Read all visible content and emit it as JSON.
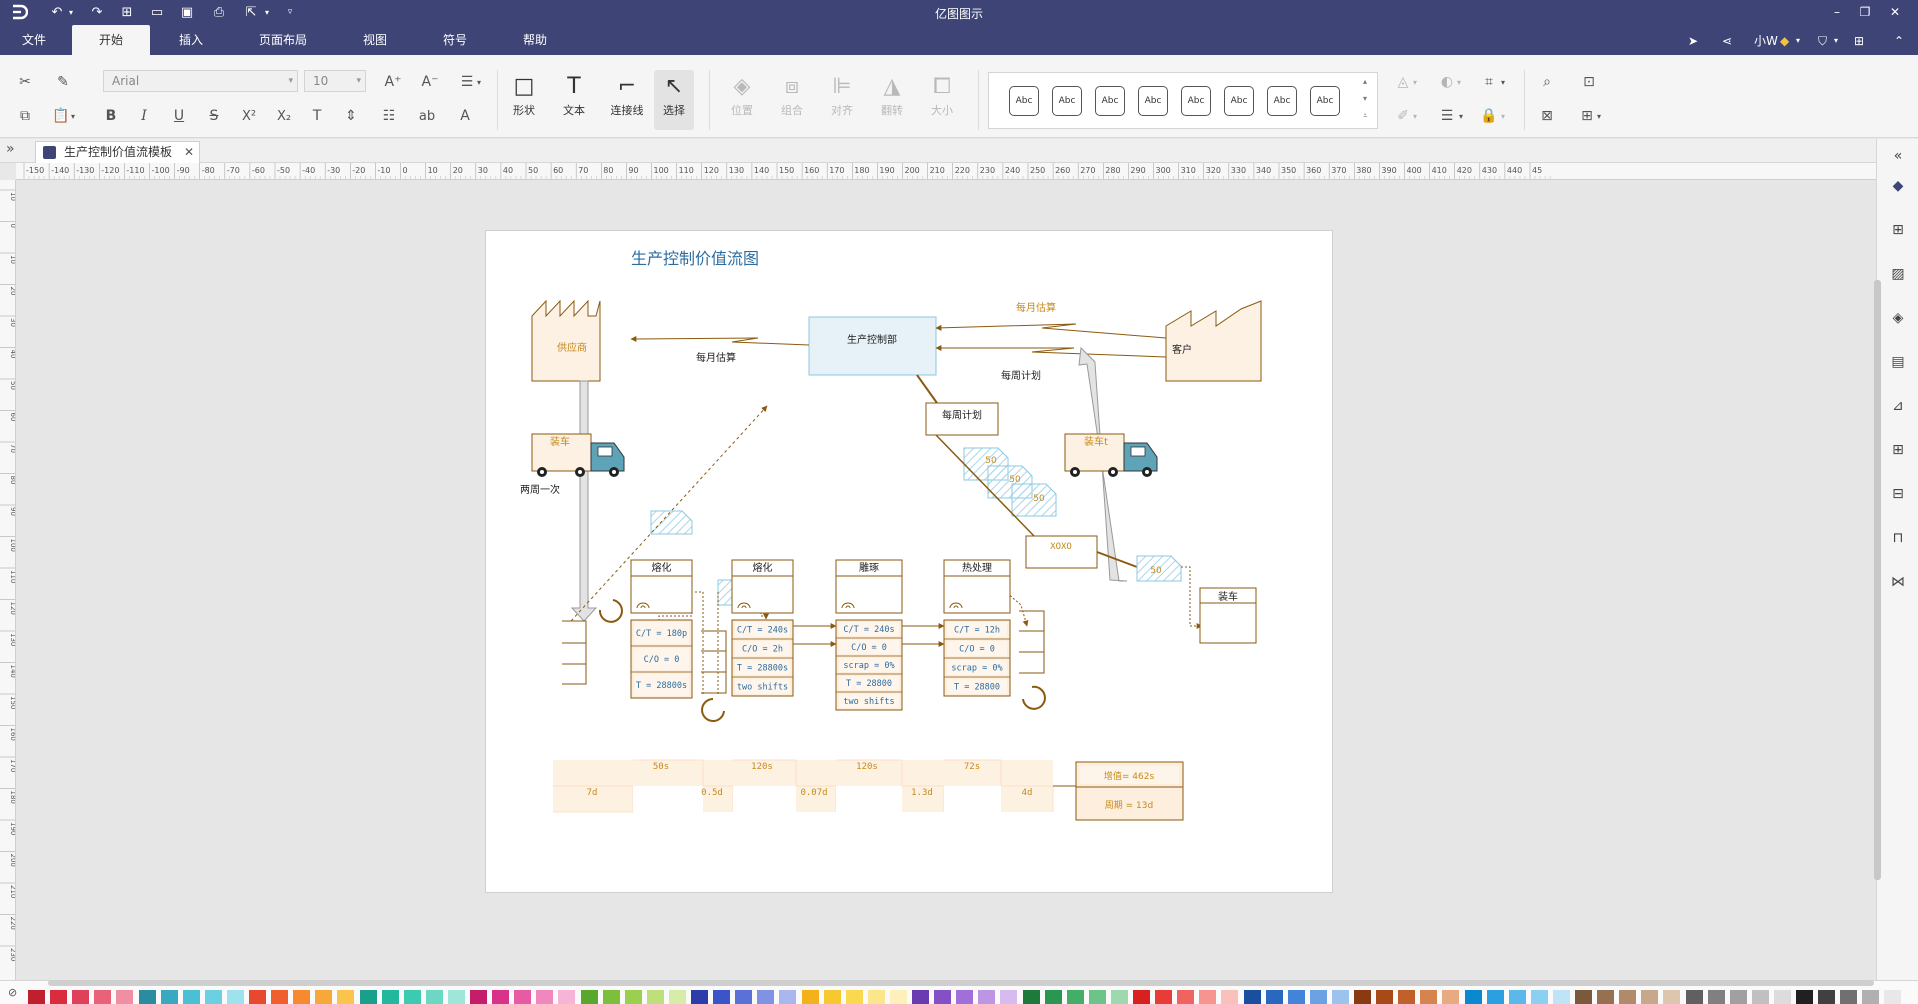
{
  "app": {
    "title": "亿图图示",
    "user": "小W"
  },
  "menu": {
    "items": [
      {
        "label": "文件"
      },
      {
        "label": "开始"
      },
      {
        "label": "插入"
      },
      {
        "label": "页面布局"
      },
      {
        "label": "视图"
      },
      {
        "label": "符号"
      },
      {
        "label": "帮助"
      }
    ]
  },
  "ribbon": {
    "font_family": "Arial",
    "font_size": "10",
    "shape_label": "形状",
    "text_label": "文本",
    "connector_label": "连接线",
    "select_label": "选择",
    "position_label": "位置",
    "group_label": "组合",
    "align_label": "对齐",
    "flip_label": "翻转",
    "size_label": "大小",
    "style_sample": "Abc",
    "superscript": "X²",
    "subscript": "X₂",
    "abbr": "ab"
  },
  "tabs": [
    {
      "label": "生产控制价值流模板"
    }
  ],
  "ruler": {
    "h_ticks": [
      "-150",
      "-140",
      "-130",
      "-120",
      "-110",
      "-100",
      "-90",
      "-80",
      "-70",
      "-60",
      "-50",
      "-40",
      "-30",
      "-20",
      "-10",
      "0",
      "10",
      "20",
      "30",
      "40",
      "50",
      "60",
      "70",
      "80",
      "90",
      "100",
      "110",
      "120",
      "130",
      "140",
      "150",
      "160",
      "170",
      "180",
      "190",
      "200",
      "210",
      "220",
      "230",
      "240",
      "250",
      "260",
      "270",
      "280",
      "290",
      "300",
      "310",
      "320",
      "330",
      "340",
      "350",
      "360",
      "370",
      "380",
      "390",
      "400",
      "410",
      "420",
      "430",
      "440",
      "45"
    ],
    "v_ticks": [
      "10",
      "0",
      "10",
      "20",
      "30",
      "40",
      "50",
      "60",
      "70",
      "80",
      "90",
      "100",
      "110",
      "120",
      "130",
      "140",
      "150",
      "160",
      "170",
      "180",
      "190",
      "200",
      "210",
      "220",
      "230"
    ]
  },
  "diagram": {
    "title": "生产控制价值流图",
    "supplier": "供应商",
    "customer": "客户",
    "control": "生产控制部",
    "monthly_forecast_left": "每月估算",
    "monthly_forecast_right": "每月估算",
    "weekly_plan_right": "每周计划",
    "weekly_plan_box": "每周计划",
    "truck_left": "装车",
    "truck_right": "装车t",
    "biweekly": "两周一次",
    "kanban": [
      "50",
      "50",
      "50"
    ],
    "xoxo": "XOXO",
    "kanban_right": "50",
    "shipping": "装车",
    "processes": [
      {
        "name": "熔化",
        "rows": [
          "C/T = 180p",
          "C/O = 0",
          "T = 28800s"
        ]
      },
      {
        "name": "熔化",
        "rows": [
          "C/T = 240s",
          "C/O = 2h",
          "T = 28800s",
          "two shifts"
        ]
      },
      {
        "name": "雕琢",
        "rows": [
          "C/T = 240s",
          "C/O = 0",
          "scrap = 0%",
          "T = 28800",
          "two shifts"
        ]
      },
      {
        "name": "热处理",
        "rows": [
          "C/T = 12h",
          "C/O = 0",
          "scrap = 0%",
          "T = 28800"
        ]
      }
    ],
    "timeline_top": [
      "50s",
      "120s",
      "120s",
      "72s"
    ],
    "timeline_bottom": [
      "7d",
      "0.5d",
      "0.07d",
      "1.3d",
      "4d"
    ],
    "summary_value": "增值= 462s",
    "summary_cycle": "周期 = 13d"
  },
  "colors": {
    "titlebar": "#3e4476",
    "accent_brown": "#8b5a10",
    "label_orange": "#c58a1a",
    "value_blue": "#2d6c9f",
    "factory_fill": "#fdf1e4",
    "timeline_fill": "#fdeedd",
    "control_fill": "#e6f1f8",
    "kanban_blue": "#8cc8e0"
  },
  "icons": {
    "logo": "edraw-logo-icon",
    "undo": "undo-icon",
    "redo": "redo-icon"
  }
}
